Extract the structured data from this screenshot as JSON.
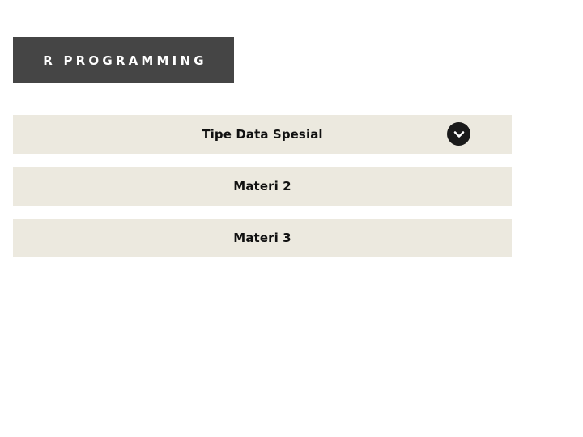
{
  "header": {
    "title": "R PROGRAMMING"
  },
  "accordion": {
    "items": [
      {
        "label": "Tipe Data Spesial",
        "icon": "chevron-down-icon",
        "expanded": false
      },
      {
        "label": "Materi 2"
      },
      {
        "label": "Materi 3"
      }
    ]
  },
  "colors": {
    "banner_bg": "#454545",
    "banner_text": "#ffffff",
    "item_bg": "#ece9df",
    "item_text": "#111111",
    "icon_bg": "#1a1a1a"
  }
}
